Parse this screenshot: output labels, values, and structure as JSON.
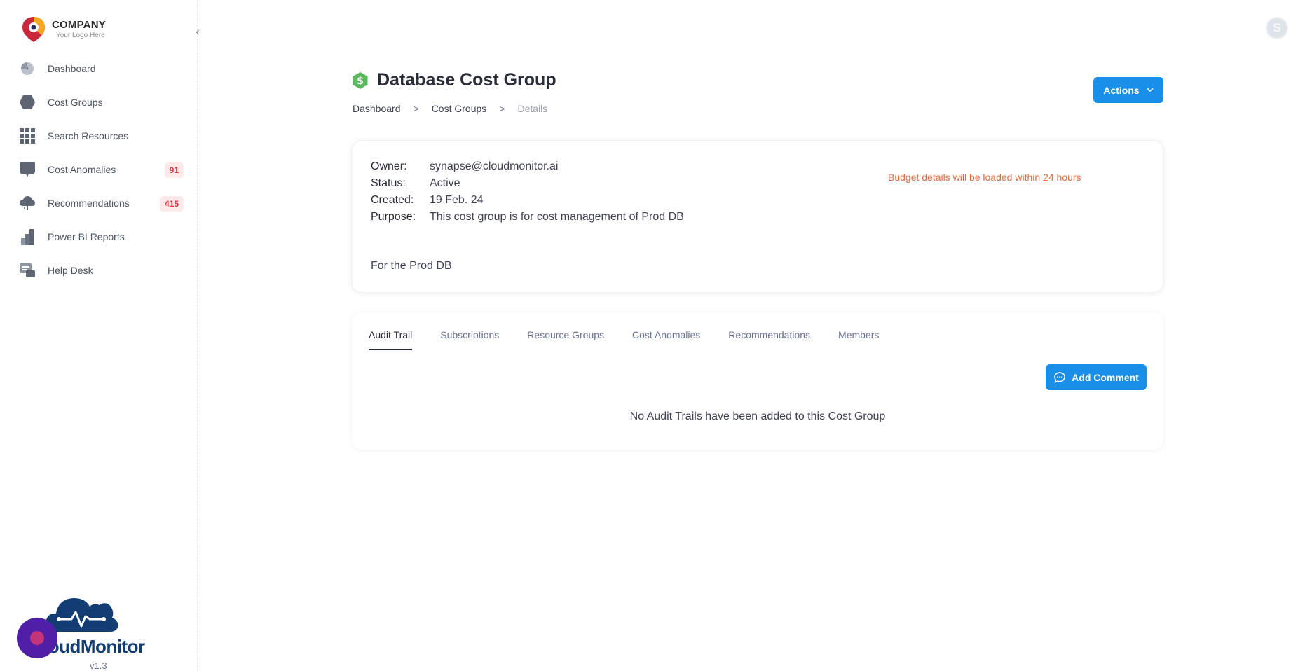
{
  "brand": {
    "company": "COMPANY",
    "tagline": "Your Logo Here",
    "product": "loudMonitor",
    "version": "v1.3",
    "accent": "#1a8fe8"
  },
  "sidebar": {
    "items": [
      {
        "label": "Dashboard",
        "icon": "gauge-icon"
      },
      {
        "label": "Cost Groups",
        "icon": "hexagon-icon"
      },
      {
        "label": "Search Resources",
        "icon": "grid-icon"
      },
      {
        "label": "Cost Anomalies",
        "icon": "chat-icon",
        "badge": "91"
      },
      {
        "label": "Recommendations",
        "icon": "cloud-icon",
        "badge": "415"
      },
      {
        "label": "Power BI Reports",
        "icon": "bar-chart-icon"
      },
      {
        "label": "Help Desk",
        "icon": "help-desk-icon"
      }
    ]
  },
  "user": {
    "initial": "S"
  },
  "header": {
    "title": "Database Cost Group",
    "actions_label": "Actions",
    "breadcrumb": [
      "Dashboard",
      ">",
      "Cost Groups",
      ">",
      "Details"
    ]
  },
  "details": {
    "owner_key": "Owner:",
    "owner": "synapse@cloudmonitor.ai",
    "status_key": "Status:",
    "status": "Active",
    "created_key": "Created:",
    "created": "19 Feb. 24",
    "purpose_key": "Purpose:",
    "purpose": "This cost group is for cost management of Prod DB",
    "note": "For the Prod DB",
    "budget_note": "Budget details will be loaded within 24 hours"
  },
  "tabs": [
    "Audit Trail",
    "Subscriptions",
    "Resource Groups",
    "Cost Anomalies",
    "Recommendations",
    "Members"
  ],
  "audit": {
    "add_comment_label": "Add Comment",
    "empty_message": "No Audit Trails have been added to this Cost Group"
  }
}
